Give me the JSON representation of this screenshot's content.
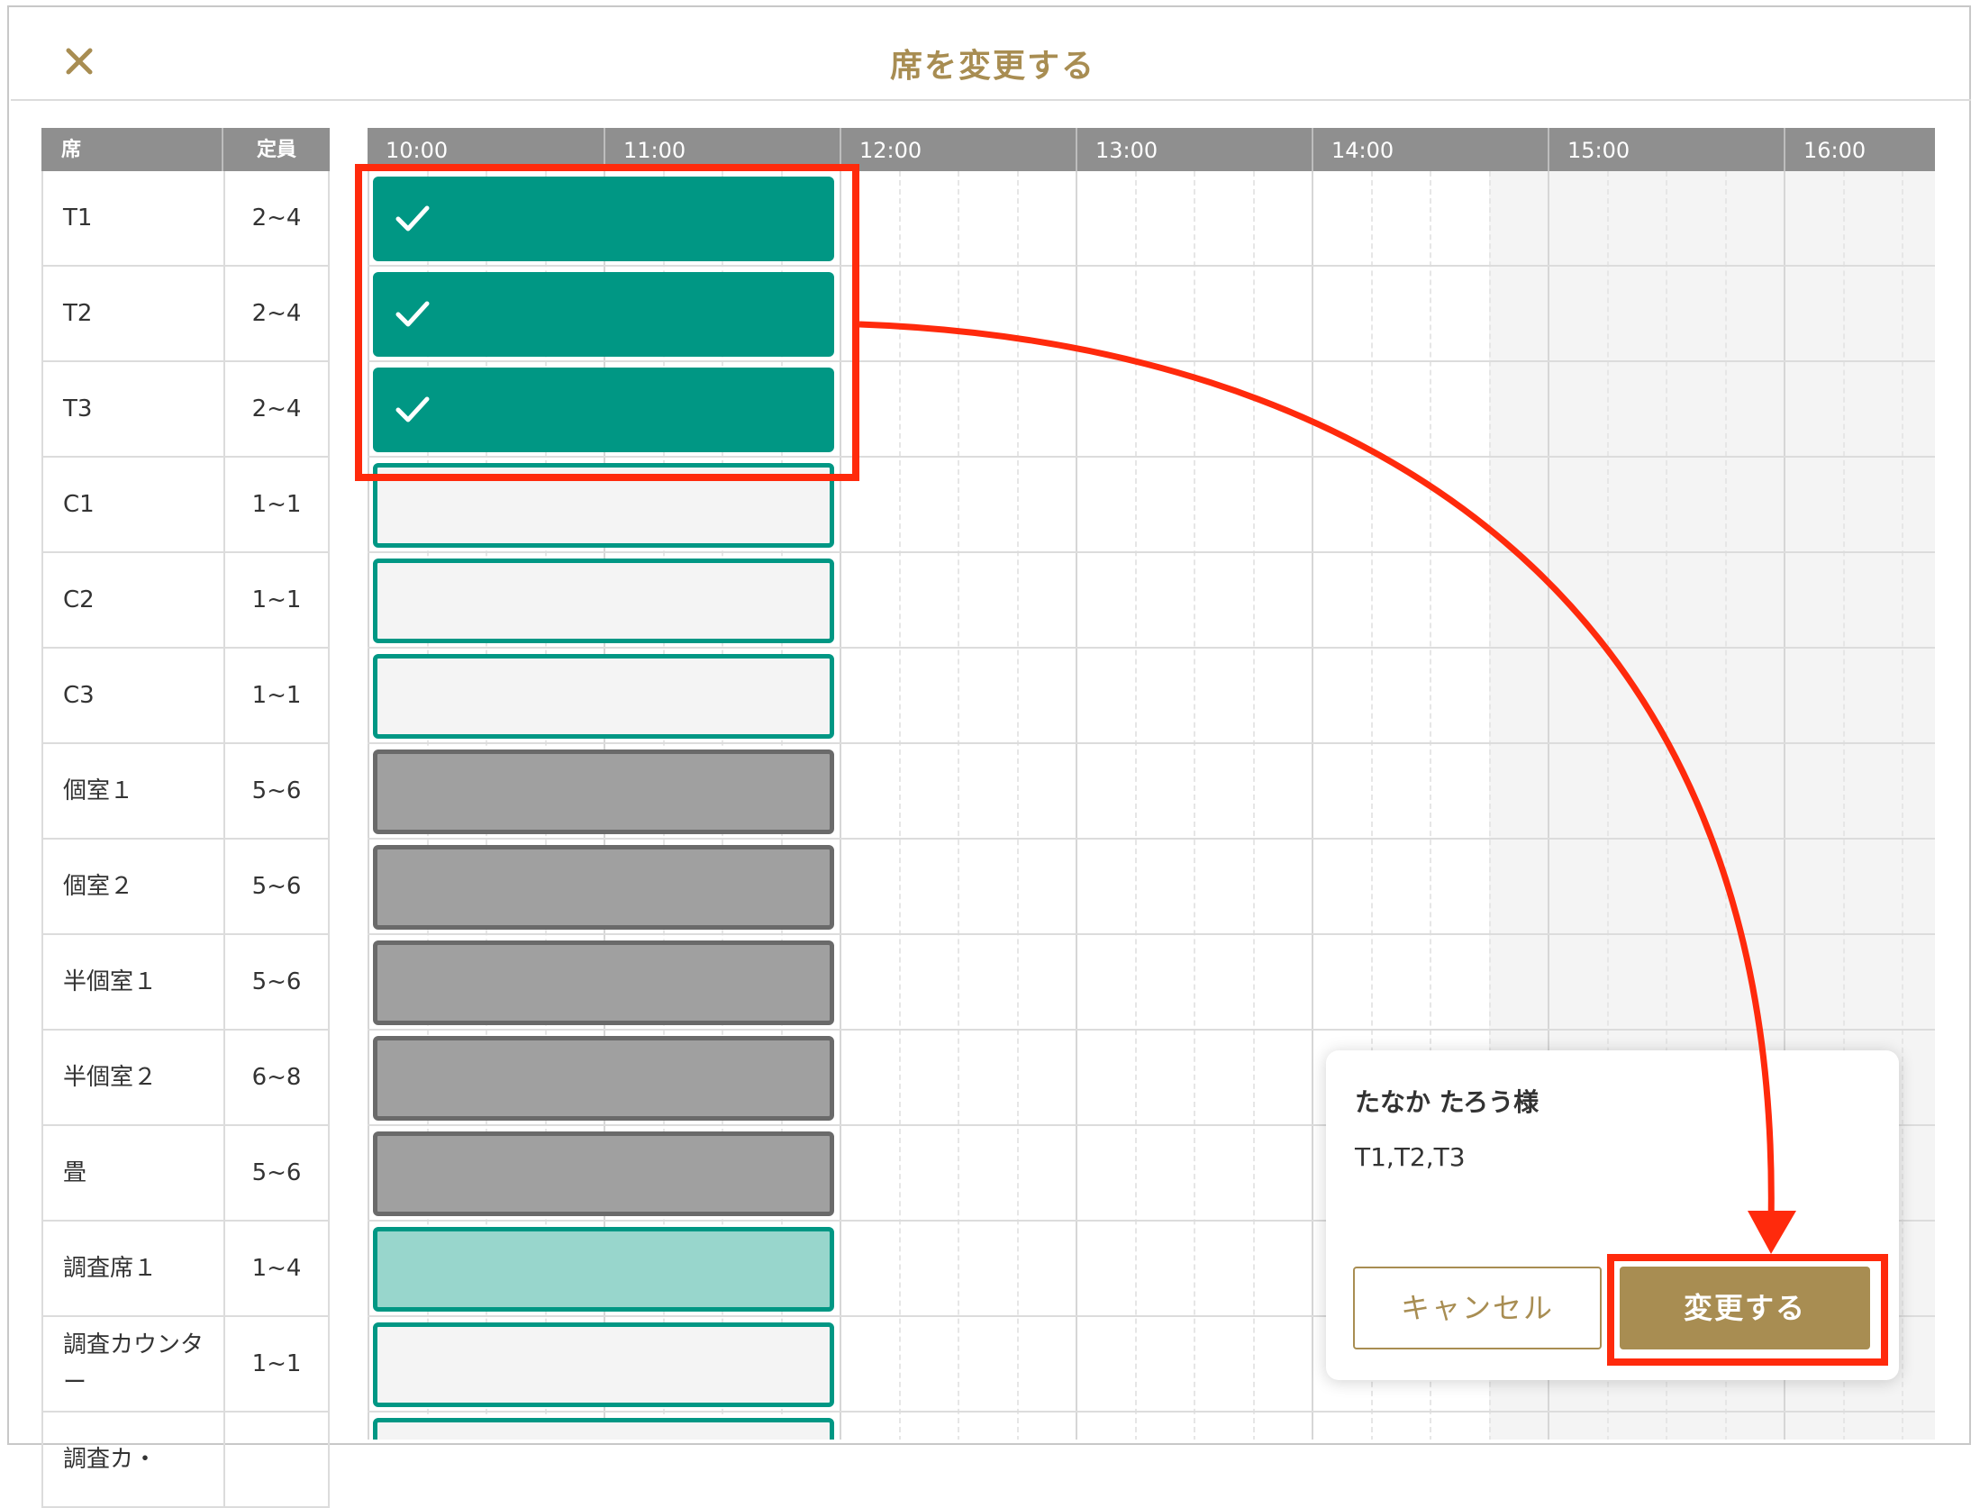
{
  "modal": {
    "title": "席を変更する",
    "close_icon": "close-icon"
  },
  "colors": {
    "accent": "#a88d52",
    "selected": "#009784",
    "occupied": "#a0a0a0",
    "annotation": "#ff2a0c"
  },
  "seat_table": {
    "header_seat": "席",
    "header_capacity": "定員",
    "rows": [
      {
        "name": "T1",
        "capacity": "2~4",
        "slot": "selected"
      },
      {
        "name": "T2",
        "capacity": "2~4",
        "slot": "selected"
      },
      {
        "name": "T3",
        "capacity": "2~4",
        "slot": "selected"
      },
      {
        "name": "C1",
        "capacity": "1~1",
        "slot": "free"
      },
      {
        "name": "C2",
        "capacity": "1~1",
        "slot": "free"
      },
      {
        "name": "C3",
        "capacity": "1~1",
        "slot": "free"
      },
      {
        "name": "個室１",
        "capacity": "5~6",
        "slot": "occupied"
      },
      {
        "name": "個室２",
        "capacity": "5~6",
        "slot": "occupied"
      },
      {
        "name": "半個室１",
        "capacity": "5~6",
        "slot": "occupied"
      },
      {
        "name": "半個室２",
        "capacity": "6~8",
        "slot": "occupied"
      },
      {
        "name": "畳",
        "capacity": "5~6",
        "slot": "occupied"
      },
      {
        "name": "調査席１",
        "capacity": "1~4",
        "slot": "light"
      },
      {
        "name": "調査カウンター",
        "capacity": "1~1",
        "slot": "free"
      },
      {
        "name": "調査カ・",
        "capacity": "",
        "slot": "free"
      }
    ]
  },
  "timeline": {
    "hours": [
      "10:00",
      "11:00",
      "12:00",
      "13:00",
      "14:00",
      "15:00",
      "16:00"
    ]
  },
  "popup": {
    "customer_name": "たなか たろう様",
    "seats": "T1,T2,T3",
    "cancel_label": "キャンセル",
    "confirm_label": "変更する"
  }
}
